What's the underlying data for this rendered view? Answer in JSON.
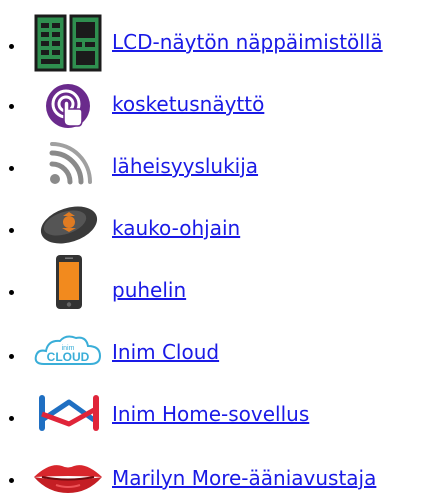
{
  "items": [
    {
      "label": "LCD-näytön näppäimistöllä",
      "icon": "lcd-keypad-icon"
    },
    {
      "label": "kosketusnäyttö",
      "icon": "touchscreen-icon"
    },
    {
      "label": "läheisyyslukija",
      "icon": "proximity-reader-icon"
    },
    {
      "label": "kauko-ohjain",
      "icon": "remote-control-icon"
    },
    {
      "label": "puhelin",
      "icon": "phone-icon"
    },
    {
      "label": "Inim Cloud",
      "icon": "inim-cloud-icon",
      "icon_text_top": "inim",
      "icon_text": "CLOUD"
    },
    {
      "label": "Inim Home-sovellus",
      "icon": "inim-home-app-icon"
    },
    {
      "label": "Marilyn More-ääniavustaja",
      "icon": "lips-icon"
    }
  ],
  "colors": {
    "link": "#1a1ae6",
    "lcd_green": "#2f8f4f",
    "touch_purple": "#6a2a8c",
    "remote_orange": "#e07b22",
    "phone_orange": "#f28a1e",
    "cloud_blue": "#3aaed8",
    "home_blue": "#1f6fc2",
    "home_red": "#e0253a",
    "lips_red": "#d8262c"
  }
}
